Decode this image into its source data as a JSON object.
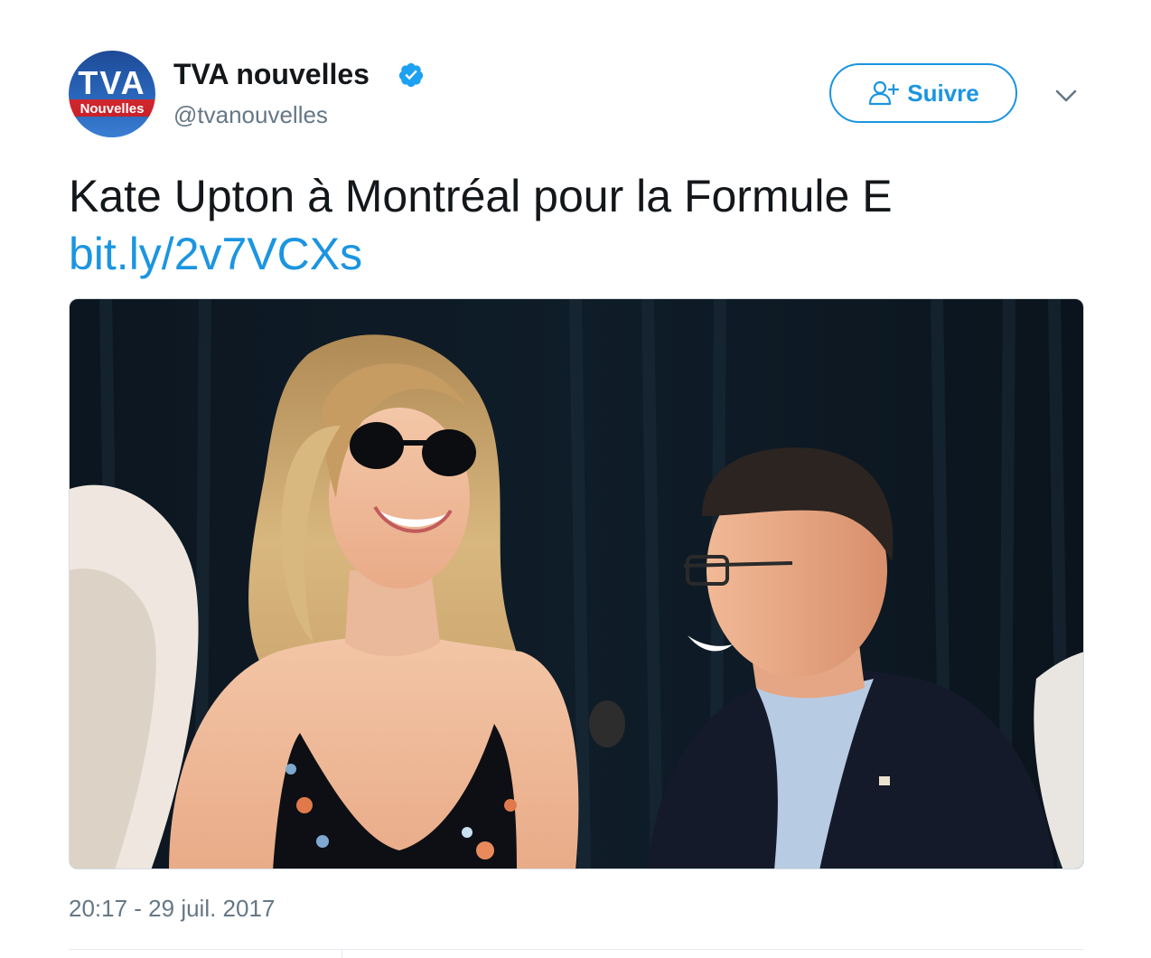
{
  "author": {
    "display_name": "TVA nouvelles",
    "handle": "@tvanouvelles",
    "verified": true,
    "avatar": {
      "logo_text": "TVA",
      "logo_subtext": "Nouvelles"
    }
  },
  "actions": {
    "follow_label": "Suivre",
    "follow_icon": "add-user-icon",
    "more_icon": "chevron-down-icon"
  },
  "tweet": {
    "text": "Kate Upton à Montréal pour la Formule E",
    "link": "bit.ly/2v7VCXs"
  },
  "media": {
    "type": "photo"
  },
  "meta": {
    "timestamp": "20:17 - 29 juil. 2017"
  },
  "colors": {
    "accent": "#1b95e0",
    "text": "#14171a",
    "secondary_text": "#657786",
    "verified_badge": "#1da1f2"
  }
}
